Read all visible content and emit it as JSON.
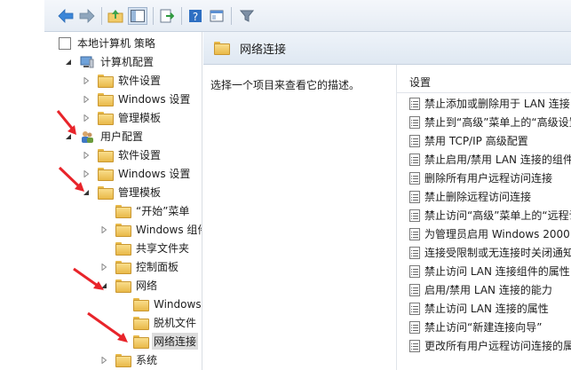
{
  "tree": {
    "root": "本地计算机 策略",
    "computer_config": "计算机配置",
    "cc_software": "软件设置",
    "cc_windows": "Windows 设置",
    "cc_admin": "管理模板",
    "user_config": "用户配置",
    "uc_software": "软件设置",
    "uc_windows": "Windows 设置",
    "uc_admin": "管理模板",
    "start_menu": "“开始”菜单",
    "windows_components": "Windows 组件",
    "shared_folders": "共享文件夹",
    "control_panel": "控制面板",
    "network": "网络",
    "windows_sub": "Windows",
    "offline_files": "脱机文件",
    "network_connections": "网络连接",
    "system": "系统"
  },
  "right_header": {
    "title": "网络连接"
  },
  "description": {
    "text": "选择一个项目来查看它的描述。"
  },
  "list": {
    "column_header": "设置",
    "items": [
      "禁止添加或删除用于 LAN 连接",
      "禁止到“高级”菜单上的“高级设置”",
      "禁用 TCP/IP 高级配置",
      "禁止启用/禁用 LAN 连接的组件",
      "删除所有用户远程访问连接",
      "禁止删除远程访问连接",
      "禁止访问“高级”菜单上的“远程访问首选项”",
      "为管理员启用 Windows 2000",
      "连接受限制或无连接时关闭通知",
      "禁止访问 LAN 连接组件的属性",
      "启用/禁用 LAN 连接的能力",
      "禁止访问 LAN 连接的属性",
      "禁止访问“新建连接向导”",
      "更改所有用户远程访问连接的属性"
    ]
  },
  "colors": {
    "arrow": "#e8242a",
    "folder": "#f2cc6b",
    "header_bg": "#e6edf5"
  }
}
